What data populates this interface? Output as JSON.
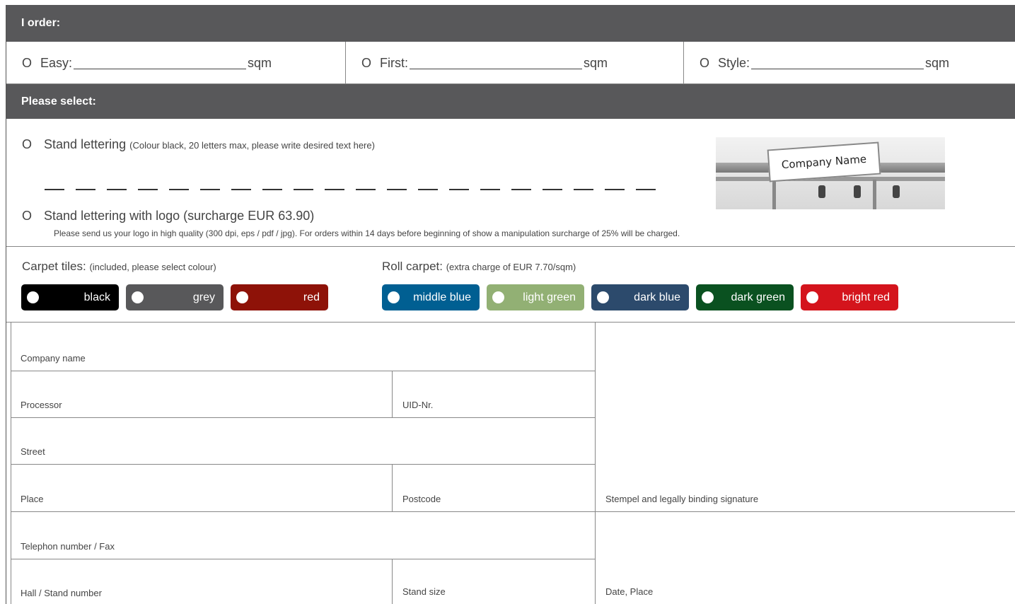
{
  "header": {
    "order_title": "I order:",
    "select_title": "Please select:"
  },
  "order_options": [
    {
      "label": "Easy:",
      "unit": "sqm"
    },
    {
      "label": "First:",
      "unit": "sqm"
    },
    {
      "label": "Style:",
      "unit": "sqm"
    }
  ],
  "radio_glyph": "O",
  "lettering": {
    "option1_label": "Stand lettering",
    "option1_note": "(Colour black, 20 letters max, please write desired text here)",
    "option2_label": "Stand lettering with logo (surcharge EUR 63.90)",
    "option2_note": "Please send us your logo in high quality (300 dpi, eps / pdf / jpg). For orders within 14 days before beginning of show a manipulation surcharge of 25% will be charged.",
    "image_sign_text": "Company Name",
    "letter_slots": 20
  },
  "carpet_tiles": {
    "title": "Carpet tiles:",
    "note": "(included, please select colour)",
    "colours": [
      {
        "name": "black",
        "color": "#000000"
      },
      {
        "name": "grey",
        "color": "#58585a"
      },
      {
        "name": "red",
        "color": "#8e1208"
      }
    ]
  },
  "roll_carpet": {
    "title": "Roll carpet:",
    "note": "(extra charge of EUR 7.70/sqm)",
    "colours": [
      {
        "name": "middle blue",
        "color": "#005f92"
      },
      {
        "name": "light green",
        "color": "#92b074"
      },
      {
        "name": "dark blue",
        "color": "#2c4a6c"
      },
      {
        "name": "dark green",
        "color": "#0a5120"
      },
      {
        "name": "bright red",
        "color": "#d4141c"
      }
    ]
  },
  "fields": {
    "company_name": "Company name",
    "processor": "Processor",
    "uid": "UID-Nr.",
    "street": "Street",
    "place": "Place",
    "postcode": "Postcode",
    "telephone": "Telephon number / Fax",
    "hall_stand": "Hall / Stand number",
    "stand_size": "Stand size",
    "signature": "Stempel and legally binding signature",
    "date_place": "Date, Place"
  }
}
